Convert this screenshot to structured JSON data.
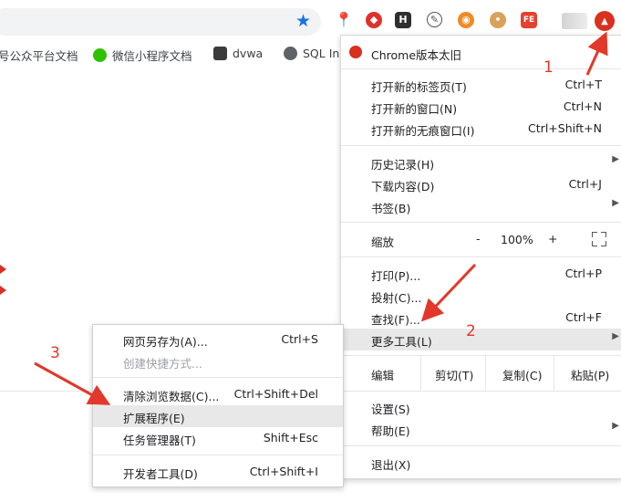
{
  "bookmarks": [
    {
      "label": "号公众平台文档",
      "icon": "doc-icon"
    },
    {
      "label": "微信小程序文档",
      "icon": "wechat-icon"
    },
    {
      "label": "dvwa",
      "icon": "dvwa-icon"
    },
    {
      "label": "SQL In",
      "icon": "globe-icon"
    }
  ],
  "extensions": [
    "location-pin-icon",
    "shield-icon",
    "h-icon",
    "leaf-icon",
    "compass-icon",
    "cookie-icon",
    "fe-icon"
  ],
  "main_menu": {
    "update_notice": "Chrome版本太旧",
    "new_tab": {
      "label": "打开新的标签页(T)",
      "shortcut": "Ctrl+T"
    },
    "new_window": {
      "label": "打开新的窗口(N)",
      "shortcut": "Ctrl+N"
    },
    "new_incognito": {
      "label": "打开新的无痕窗口(I)",
      "shortcut": "Ctrl+Shift+N"
    },
    "history": {
      "label": "历史记录(H)"
    },
    "downloads": {
      "label": "下载内容(D)",
      "shortcut": "Ctrl+J"
    },
    "bookmarks": {
      "label": "书签(B)"
    },
    "zoom": {
      "label": "缩放",
      "minus": "-",
      "value": "100%",
      "plus": "+"
    },
    "print": {
      "label": "打印(P)...",
      "shortcut": "Ctrl+P"
    },
    "cast": {
      "label": "投射(C)..."
    },
    "find": {
      "label": "查找(F)...",
      "shortcut": "Ctrl+F"
    },
    "more_tools": {
      "label": "更多工具(L)"
    },
    "edit": {
      "label": "编辑",
      "cut": "剪切(T)",
      "copy": "复制(C)",
      "paste": "粘贴(P)"
    },
    "settings": {
      "label": "设置(S)"
    },
    "help": {
      "label": "帮助(E)"
    },
    "exit": {
      "label": "退出(X)"
    }
  },
  "sub_menu": {
    "save_page": {
      "label": "网页另存为(A)...",
      "shortcut": "Ctrl+S"
    },
    "create_shortcut": {
      "label": "创建快捷方式..."
    },
    "clear_data": {
      "label": "清除浏览数据(C)...",
      "shortcut": "Ctrl+Shift+Del"
    },
    "extensions": {
      "label": "扩展程序(E)"
    },
    "task_manager": {
      "label": "任务管理器(T)",
      "shortcut": "Shift+Esc"
    },
    "dev_tools": {
      "label": "开发者工具(D)",
      "shortcut": "Ctrl+Shift+I"
    }
  },
  "annotations": {
    "step1": "1",
    "step2": "2",
    "step3": "3"
  },
  "colors": {
    "annotation": "#e2382b",
    "accent": "#1a73e8",
    "highlight": "#e8e8e8"
  }
}
